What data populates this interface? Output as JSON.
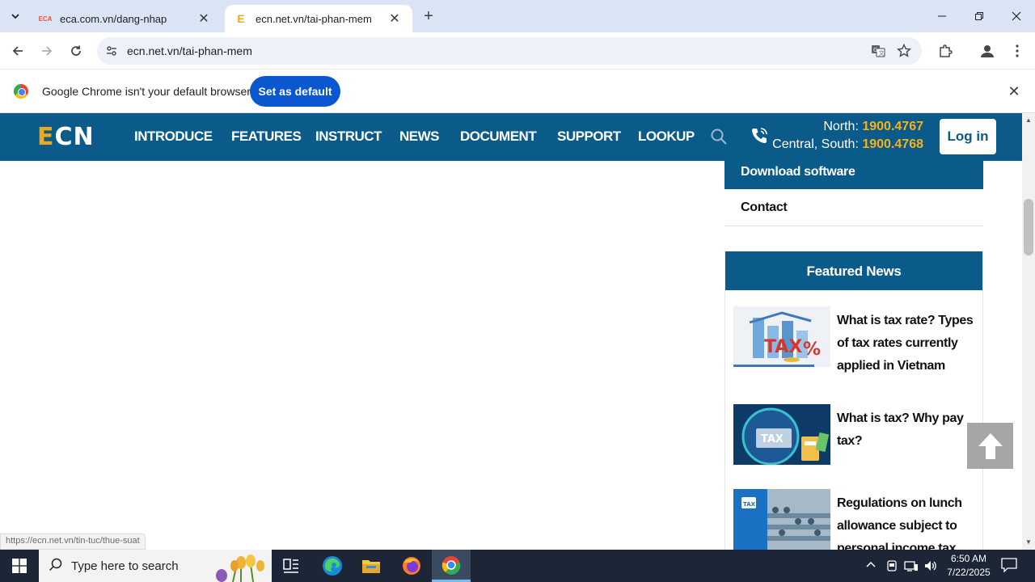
{
  "browser": {
    "tabs": [
      {
        "favicon": "ECA",
        "title": "eca.com.vn/dang-nhap"
      },
      {
        "favicon": "E",
        "title": "ecn.net.vn/tai-phan-mem"
      }
    ],
    "url": "ecn.net.vn/tai-phan-mem",
    "infobar": {
      "message": "Google Chrome isn't your default browser",
      "button": "Set as default"
    },
    "status_url": "https://ecn.net.vn/tin-tuc/thue-suat"
  },
  "site": {
    "logo": {
      "first": "E",
      "rest": "CN"
    },
    "nav": [
      "INTRODUCE",
      "FEATURES",
      "INSTRUCT",
      "NEWS",
      "DOCUMENT",
      "SUPPORT",
      "LOOKUP"
    ],
    "hotline": {
      "north_label": "North:",
      "north_number": "1900.4767",
      "south_label": "Central, South:",
      "south_number": "1900.4768"
    },
    "login": "Log in",
    "sidebar": {
      "download": "Download software",
      "contact": "Contact"
    },
    "featured": {
      "title": "Featured News",
      "items": [
        {
          "title": "What is tax rate? Types of tax rates currently applied in Vietnam"
        },
        {
          "title": "What is tax? Why pay tax?"
        },
        {
          "title": "Regulations on lunch allowance subject to personal income tax"
        }
      ]
    }
  },
  "taskbar": {
    "search_placeholder": "Type here to search",
    "time": "6:50 AM",
    "date": "7/22/2025"
  }
}
